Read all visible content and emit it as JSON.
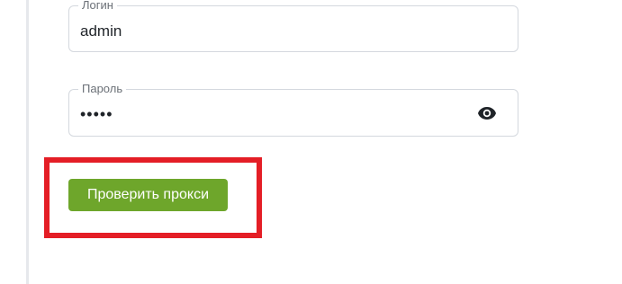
{
  "login": {
    "label": "Логин",
    "value": "admin"
  },
  "password": {
    "label": "Пароль",
    "value": "•••••",
    "toggle_icon": "eye-icon"
  },
  "actions": {
    "check_proxy_label": "Проверить прокси"
  },
  "colors": {
    "button_background": "#6ea62b",
    "highlight_border": "#e41e26",
    "field_border": "#d4d8de",
    "label_text": "#6b7077"
  }
}
